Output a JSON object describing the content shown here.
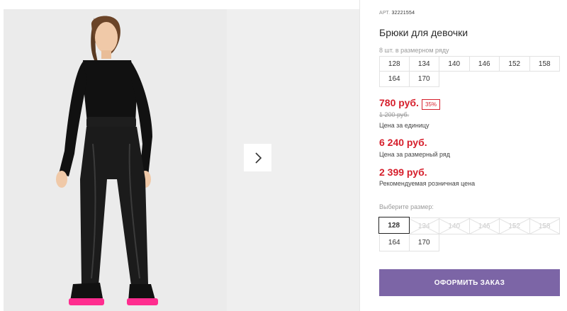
{
  "product": {
    "sku_label": "АРТ.",
    "sku": "32221554",
    "title": "Брюки для девочки"
  },
  "size_row": {
    "label": "8 шт. в размерном ряду",
    "sizes": [
      "128",
      "134",
      "140",
      "146",
      "152",
      "158",
      "164",
      "170"
    ]
  },
  "price": {
    "current": "780 руб.",
    "discount": "35%",
    "old": "1 200 руб.",
    "unit_label": "Цена за единицу",
    "row_price": "6 240 руб.",
    "row_label": "Цена за размерный ряд",
    "rrp": "2 399 руб.",
    "rrp_label": "Рекомендуемая розничная цена"
  },
  "size_select": {
    "label": "Выберите размер:",
    "selected": "128",
    "sizes": [
      {
        "value": "128",
        "available": true
      },
      {
        "value": "134",
        "available": false
      },
      {
        "value": "140",
        "available": false
      },
      {
        "value": "146",
        "available": false
      },
      {
        "value": "152",
        "available": false
      },
      {
        "value": "158",
        "available": false
      },
      {
        "value": "164",
        "available": true
      },
      {
        "value": "170",
        "available": true
      }
    ]
  },
  "order_button": {
    "label": "ОФОРМИТЬ ЗАКАЗ"
  },
  "colors": {
    "price_red": "#d61f2c",
    "button_purple": "#7c65a6"
  },
  "icons": {
    "gallery_next": "chevron-right-icon"
  }
}
